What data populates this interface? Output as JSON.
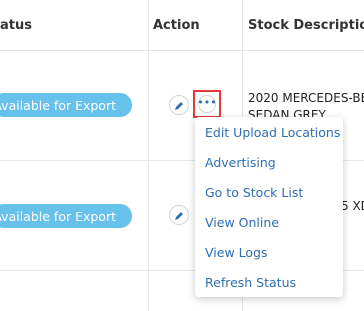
{
  "header": {
    "status_label": "atus",
    "action_label": "Action",
    "stock_description_label": "Stock Description"
  },
  "rows": [
    {
      "status": "Available for Export",
      "stock_description_line1": "2020 MERCEDES-BE",
      "stock_description_line2": "SEDAN GREY"
    },
    {
      "status": "Available for Export",
      "stock_description_fragment": "5 XD"
    }
  ],
  "action_menu": {
    "items": [
      {
        "label": "Edit Upload Locations"
      },
      {
        "label": "Advertising"
      },
      {
        "label": "Go to Stock List"
      },
      {
        "label": "View Online"
      },
      {
        "label": "View Logs"
      },
      {
        "label": "Refresh Status"
      }
    ]
  },
  "icons": {
    "edit": "pencil-icon",
    "more": "more-dots-icon"
  },
  "colors": {
    "status_pill": "#66c2ea",
    "link": "#2f6fb0",
    "highlight_border": "#e53935",
    "grid": "#e3e6ea"
  }
}
